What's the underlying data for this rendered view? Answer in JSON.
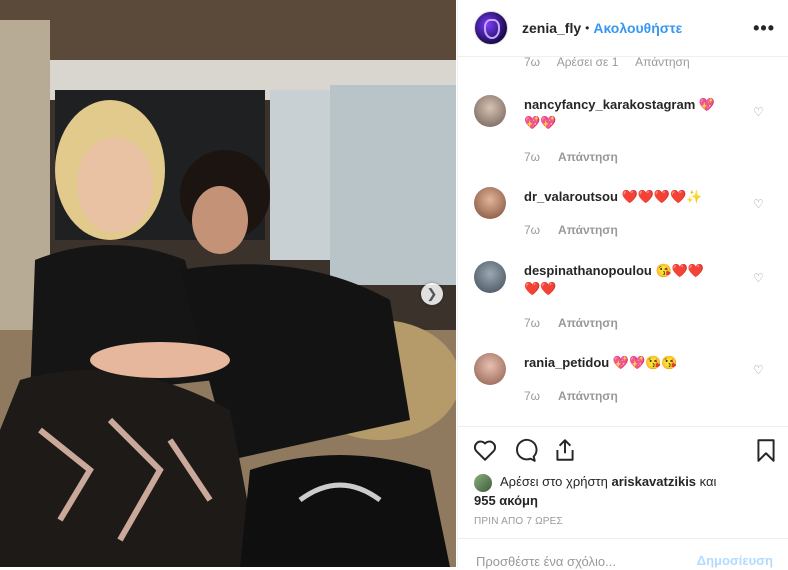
{
  "header": {
    "username": "zenia_fly",
    "separator": "•",
    "follow_label": "Ακολουθήστε",
    "more_label": "•••"
  },
  "partial_comment": {
    "time": "7ω",
    "likes": "Αρέσει σε 1",
    "reply": "Απάντηση"
  },
  "comments": [
    {
      "username": "nancyfancy_karakostagram",
      "text": "💖",
      "text2": "💖💖",
      "time": "7ω",
      "reply": "Απάντηση"
    },
    {
      "username": "dr_valaroutsou",
      "text": "❤️❤️❤️❤️✨",
      "time": "7ω",
      "reply": "Απάντηση"
    },
    {
      "username": "despinathanopoulou",
      "text": "😘❤️❤️",
      "text2": "❤️❤️",
      "time": "7ω",
      "reply": "Απάντηση"
    },
    {
      "username": "rania_petidou",
      "text": "💖💖😘😘",
      "time": "7ω",
      "reply": "Απάντηση"
    }
  ],
  "likes": {
    "prefix": "Αρέσει στο χρήστη",
    "user": "ariskavatzikis",
    "middle": "και",
    "count": "955 ακόμη"
  },
  "timestamp": "ΠΡΙΝ ΑΠΟ 7 ΩΡΕΣ",
  "add_comment": {
    "placeholder": "Προσθέστε ένα σχόλιο...",
    "post_label": "Δημοσίευση"
  },
  "icons": {
    "heart": "heart-icon",
    "comment": "comment-icon",
    "share": "share-icon",
    "save": "bookmark-icon",
    "next": "chevron-right-icon"
  },
  "colors": {
    "accent": "#3897f0",
    "muted": "#999999",
    "text": "#262626",
    "post_disabled": "#b3dbff"
  }
}
